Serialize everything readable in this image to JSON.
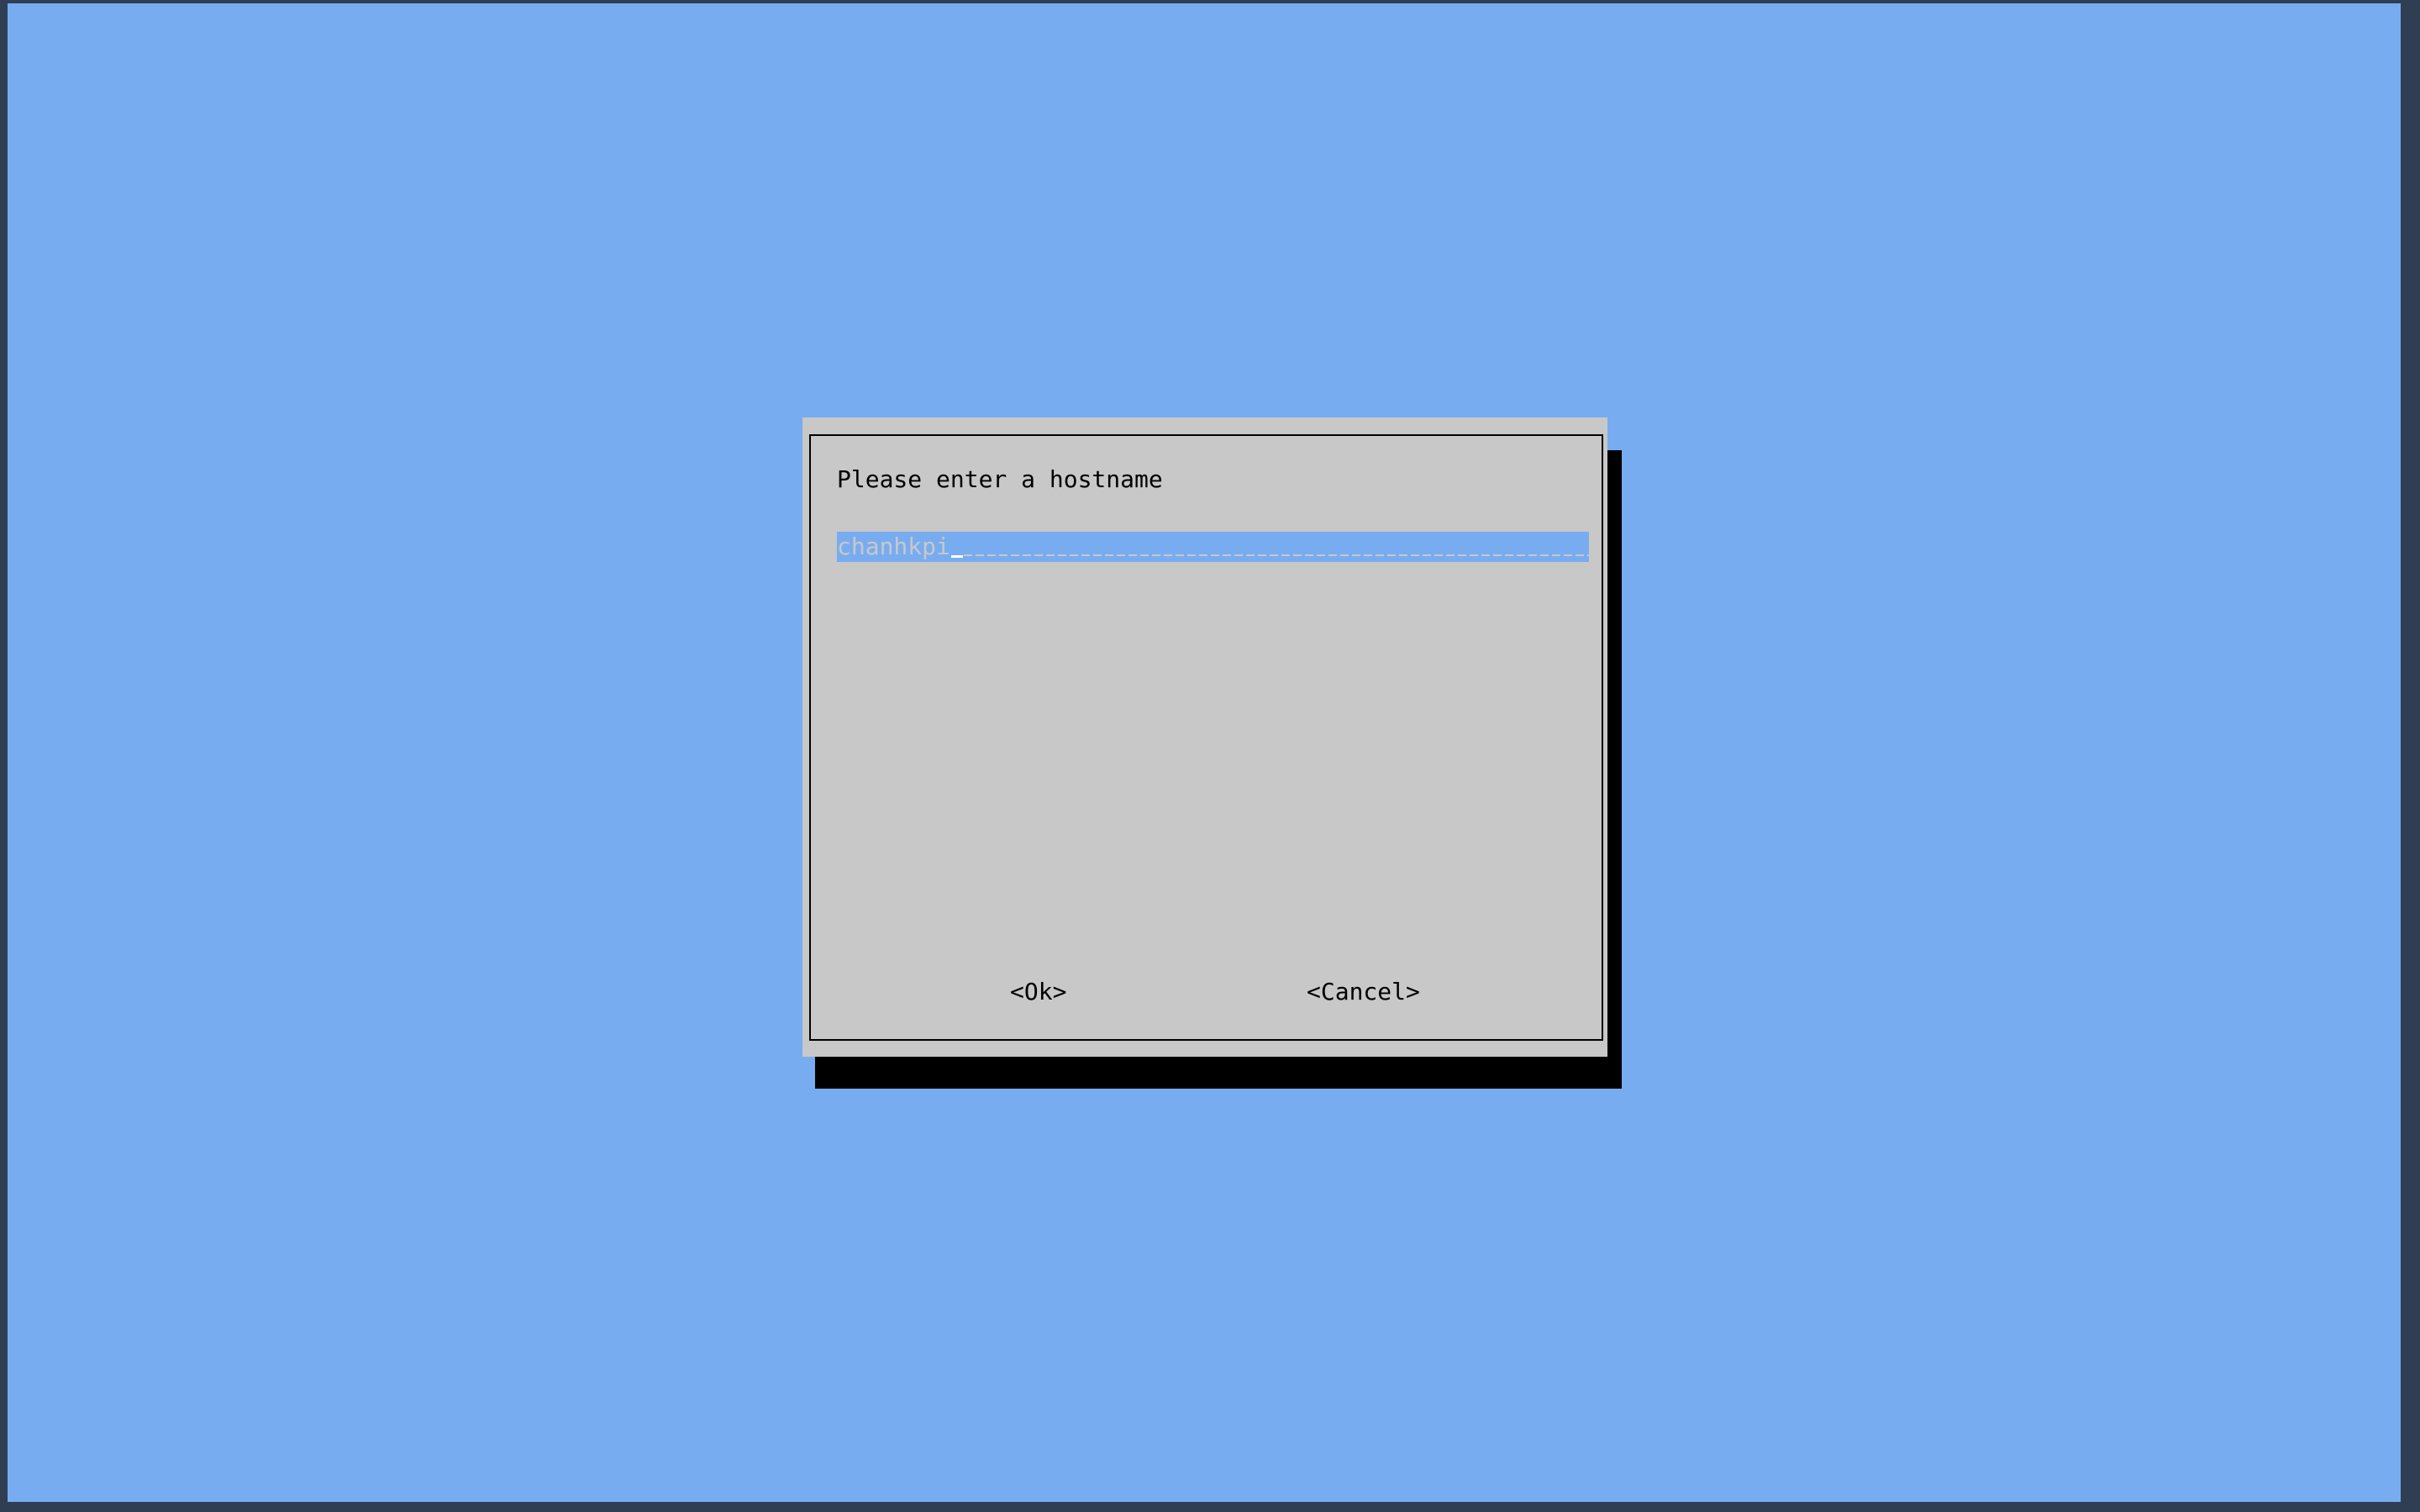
{
  "dialog": {
    "prompt": "Please enter a hostname",
    "input_value": "chanhkpi",
    "ok_label": "<Ok>",
    "cancel_label": "<Cancel>"
  },
  "colors": {
    "background": "#78acf0",
    "dialog": "#c8c8c8",
    "shadow": "#000000",
    "outer_frame": "#2f3e52"
  }
}
